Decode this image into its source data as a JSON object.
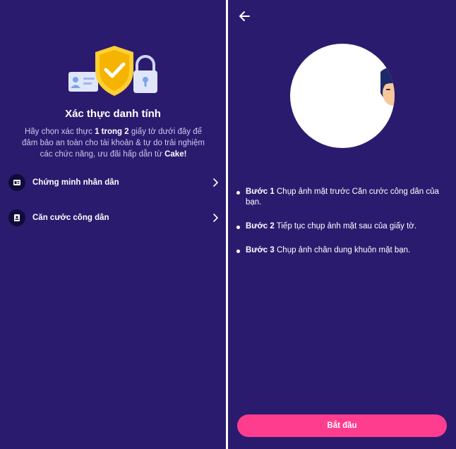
{
  "left": {
    "title": "Xác thực danh tính",
    "description": {
      "part1": "Hãy chọn xác thực ",
      "bold1": "1 trong 2",
      "part2": " giấy tờ dưới đây để đảm bảo an toàn cho tài khoản & tự do trải nghiệm các chức năng, ưu đãi hấp dẫn từ ",
      "bold2": "Cake!"
    },
    "options": [
      {
        "label": "Chứng minh nhân dân",
        "icon": "id-card-icon"
      },
      {
        "label": "Căn cước công dân",
        "icon": "citizen-id-icon"
      }
    ],
    "hero_icons": [
      "id-card-icon",
      "shield-check-icon",
      "padlock-icon"
    ]
  },
  "right": {
    "back_icon": "arrow-left-icon",
    "steps": [
      {
        "bold": "Bước 1",
        "text": " Chụp ảnh mặt trước Căn cước công dân của bạn."
      },
      {
        "bold": "Bước 2",
        "text": " Tiếp tục chụp ảnh mặt sau của giấy tờ."
      },
      {
        "bold": "Bước 3",
        "text": " Chụp ảnh chân dung khuôn mặt bạn."
      }
    ],
    "start_button": "Bắt đầu"
  },
  "colors": {
    "background": "#2b1b6e",
    "accent": "#ff3d8e",
    "shield": "#f5b400",
    "icon_bg": "#0f0b3a"
  }
}
